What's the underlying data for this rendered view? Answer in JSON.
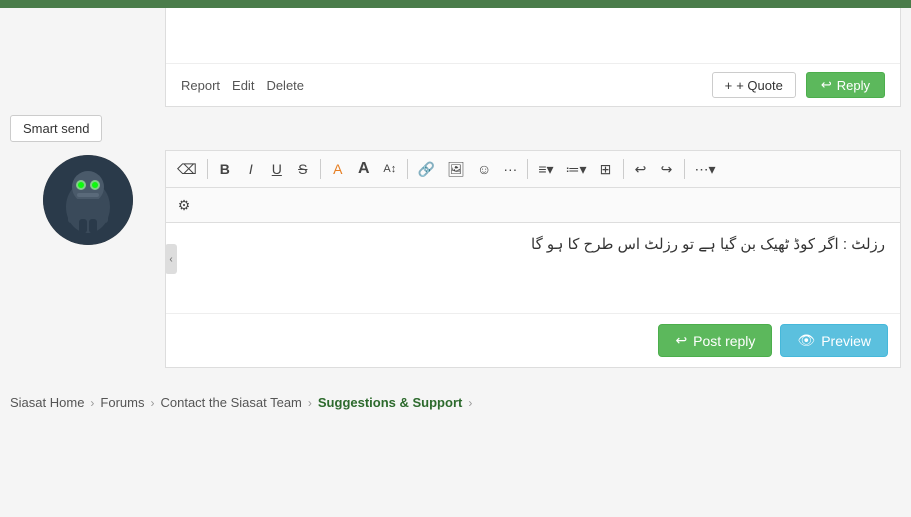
{
  "topBar": {
    "color": "#4a7c4a"
  },
  "post": {
    "report": "Report",
    "edit": "Edit",
    "delete": "Delete",
    "quote": "+ Quote",
    "reply": "Reply"
  },
  "smartSend": {
    "label": "Smart send"
  },
  "editor": {
    "toolbar": {
      "eraser": "⌫",
      "bold": "B",
      "italic": "I",
      "underline": "U",
      "strikethrough": "S",
      "highlight": "✦",
      "fontSize": "A",
      "fontSizeDown": "A↕",
      "link": "🔗",
      "image": "🖼",
      "emoji": "☺",
      "more": "···",
      "alignLeft": "≡",
      "alignRight": "≡",
      "list": "≔",
      "table": "⊞",
      "undo": "↩",
      "redo": "↪",
      "source": "⋯"
    },
    "toolbar2": {
      "settings": "⚙"
    },
    "content": "رزلٹ : اگر کوڈ ٹھیک بن گیا ہے تو رزلٹ اس طرح کا ہو گا",
    "postReply": "Post reply",
    "preview": "Preview"
  },
  "breadcrumb": {
    "items": [
      {
        "label": "Siasat Home",
        "active": false
      },
      {
        "label": "Forums",
        "active": false
      },
      {
        "label": "Contact the Siasat Team",
        "active": false
      },
      {
        "label": "Suggestions & Support",
        "active": true
      }
    ],
    "chevron": "›"
  }
}
